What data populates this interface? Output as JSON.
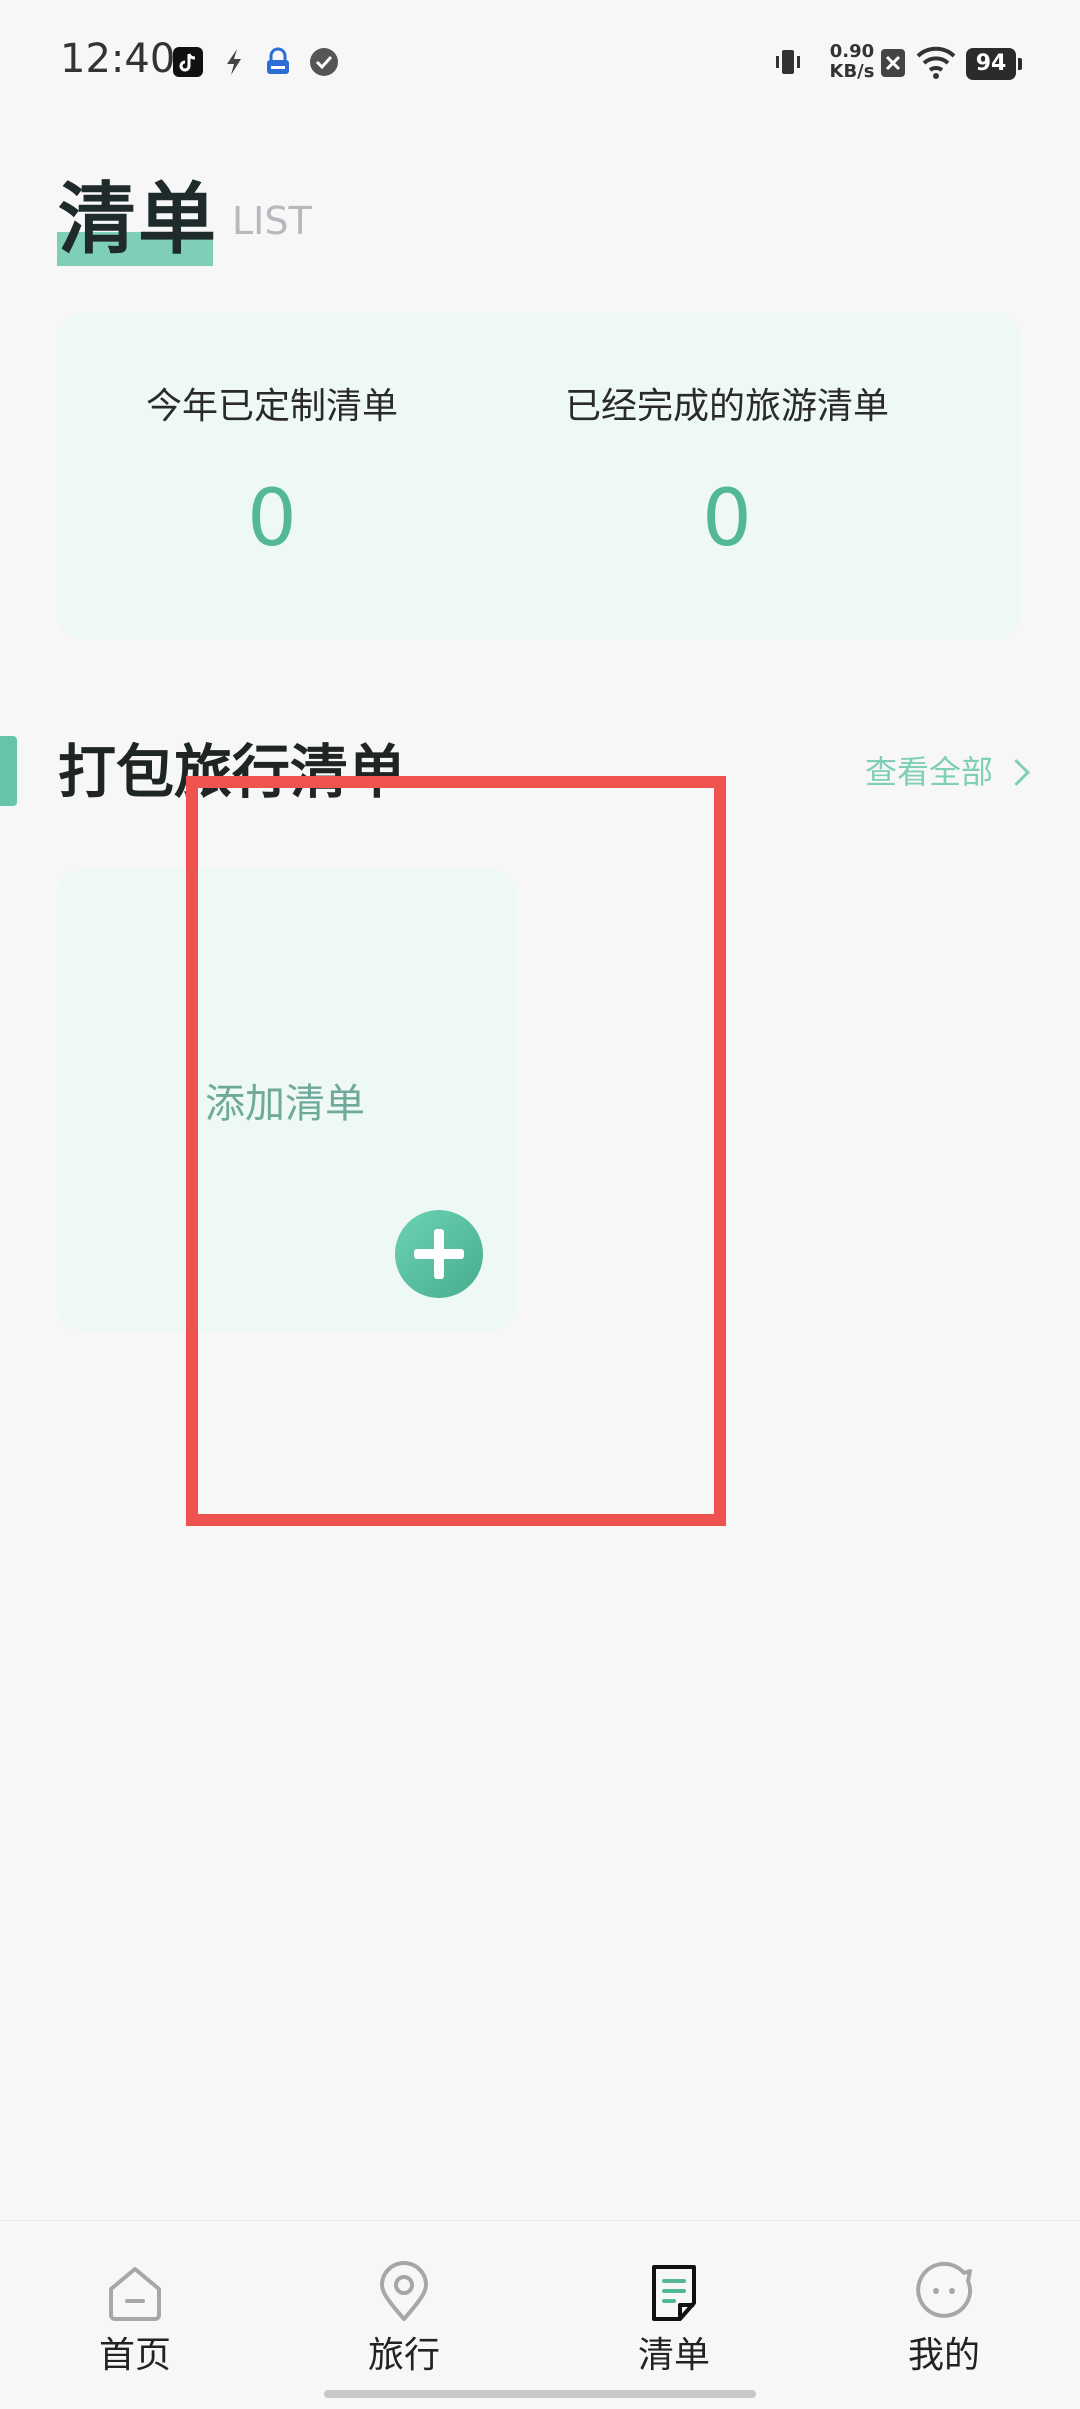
{
  "status_bar": {
    "time": "12:40",
    "net_speed_value": "0.90",
    "net_speed_unit": "KB/s",
    "battery": "94",
    "icons": [
      "tiktok-icon",
      "bolt-icon",
      "lock-app-icon",
      "check-circle-icon",
      "vibrate-icon",
      "sim-x-icon",
      "wifi-icon",
      "battery-icon"
    ]
  },
  "header": {
    "title": "清单",
    "subtitle": "LIST"
  },
  "stats": {
    "yearly_label": "今年已定制清单",
    "yearly_value": "0",
    "completed_label": "已经完成的旅游清单",
    "completed_value": "0"
  },
  "section": {
    "title": "打包旅行清单",
    "view_all": "查看全部"
  },
  "add_card": {
    "label": "添加清单"
  },
  "nav": {
    "items": [
      {
        "label": "首页",
        "icon": "home-icon"
      },
      {
        "label": "旅行",
        "icon": "location-pin-icon"
      },
      {
        "label": "清单",
        "icon": "list-document-icon"
      },
      {
        "label": "我的",
        "icon": "smiley-chat-icon"
      }
    ],
    "active_index": 2
  },
  "colors": {
    "accent": "#52b896",
    "accent_light": "#7fcfb8",
    "card_bg": "#eef8f5",
    "highlight": "#ef5350"
  }
}
